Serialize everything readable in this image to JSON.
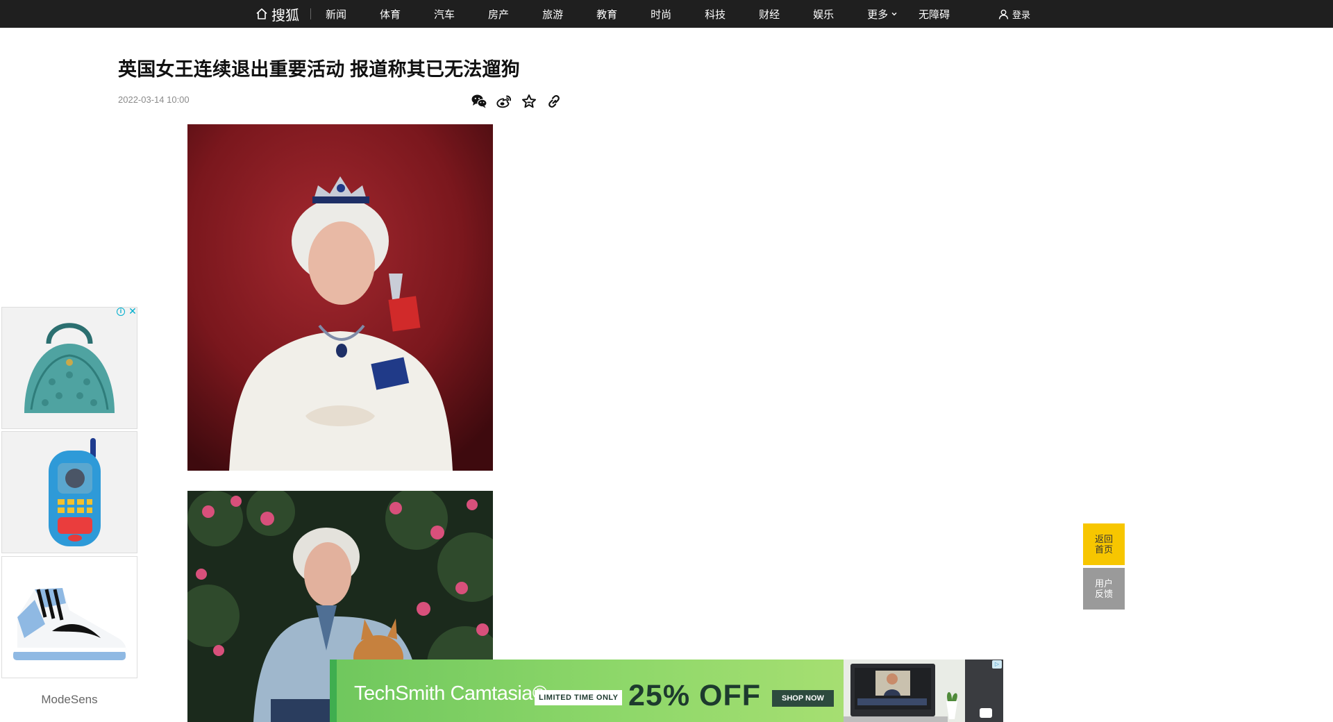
{
  "nav": {
    "logo": "搜狐",
    "items": [
      "新闻",
      "体育",
      "汽车",
      "房产",
      "旅游",
      "教育",
      "时尚",
      "科技",
      "财经",
      "娱乐"
    ],
    "more": "更多",
    "accessibility": "无障碍",
    "login": "登录"
  },
  "article": {
    "title": "英国女王连续退出重要活动 报道称其已无法遛狗",
    "time": "2022-03-14 10:00",
    "share_icons": [
      "wechat-icon",
      "weibo-icon",
      "favorite-star-icon",
      "link-icon"
    ]
  },
  "side_ad": {
    "brand": "ModeSens",
    "products": [
      "teal-croc-handbag",
      "paw-patrol-toy-phone",
      "blue-white-sneaker"
    ]
  },
  "float_buttons": {
    "home": "返回首页",
    "feedback": "用户反馈"
  },
  "bottom_ad": {
    "brand": "TechSmith Camtasia®",
    "badge": "LIMITED TIME ONLY",
    "discount": "25% OFF",
    "cta": "SHOP NOW"
  },
  "colors": {
    "nav_bg": "#1f1f1f",
    "home_button": "#f7c600",
    "feedback_button": "#9a9a9a",
    "ad_green": "#8fd86a"
  }
}
